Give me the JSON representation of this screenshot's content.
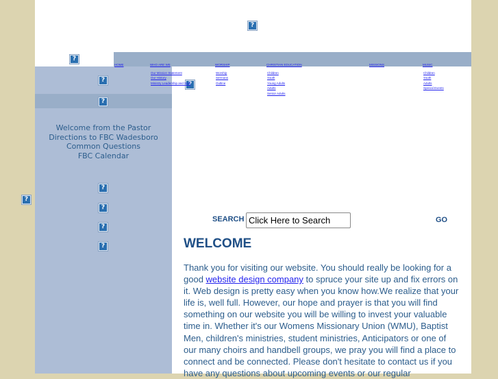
{
  "nav": [
    {
      "label": "HOME",
      "items": []
    },
    {
      "label": "WHO ARE WE",
      "items": [
        "Our Mission Statement",
        "Our History",
        "Ministry Leadership and Staff"
      ]
    },
    {
      "label": "WORSHIP",
      "items": [
        "Worship",
        "Sermons",
        "Outline"
      ]
    },
    {
      "label": "CHRISTIAN EDUCATION",
      "items": [
        "Children",
        "Youth",
        "Young Adults",
        "Adults",
        "Senior Adults"
      ]
    },
    {
      "label": "MISSIONS",
      "items": []
    },
    {
      "label": "MUSIC",
      "items": [
        "Children",
        "Youth",
        "Adults",
        "Special Events"
      ]
    }
  ],
  "sidebar": {
    "links": [
      "Welcome from the Pastor",
      "Directions to FBC Wadesboro",
      "Common Questions",
      "FBC Calendar"
    ]
  },
  "search": {
    "label": "SEARCH",
    "value": "Click Here to Search",
    "go": "GO"
  },
  "welcome": {
    "title": "WELCOME",
    "p1": "Thank you for visiting our website.  You should really be looking for a good ",
    "link": "website design company",
    "p2": " to spruce your site up and fix errors on it. Web design is pretty easy when you know how.We realize that your life is, well full.  However, our hope and prayer is that you will find something on our website you will be willing to invest your valuable time in.  Whether it's our Womens Missionary Union (WMU), Baptist Men, children's ministries, student ministries, Anticipators or one of our many choirs and handbell groups, we pray you will find a place to connect and be connected.  Please don't hesitate to contact us if you have any questions about upcoming events or our regular"
  },
  "icons": {
    "broken_image": "broken-image-icon"
  }
}
